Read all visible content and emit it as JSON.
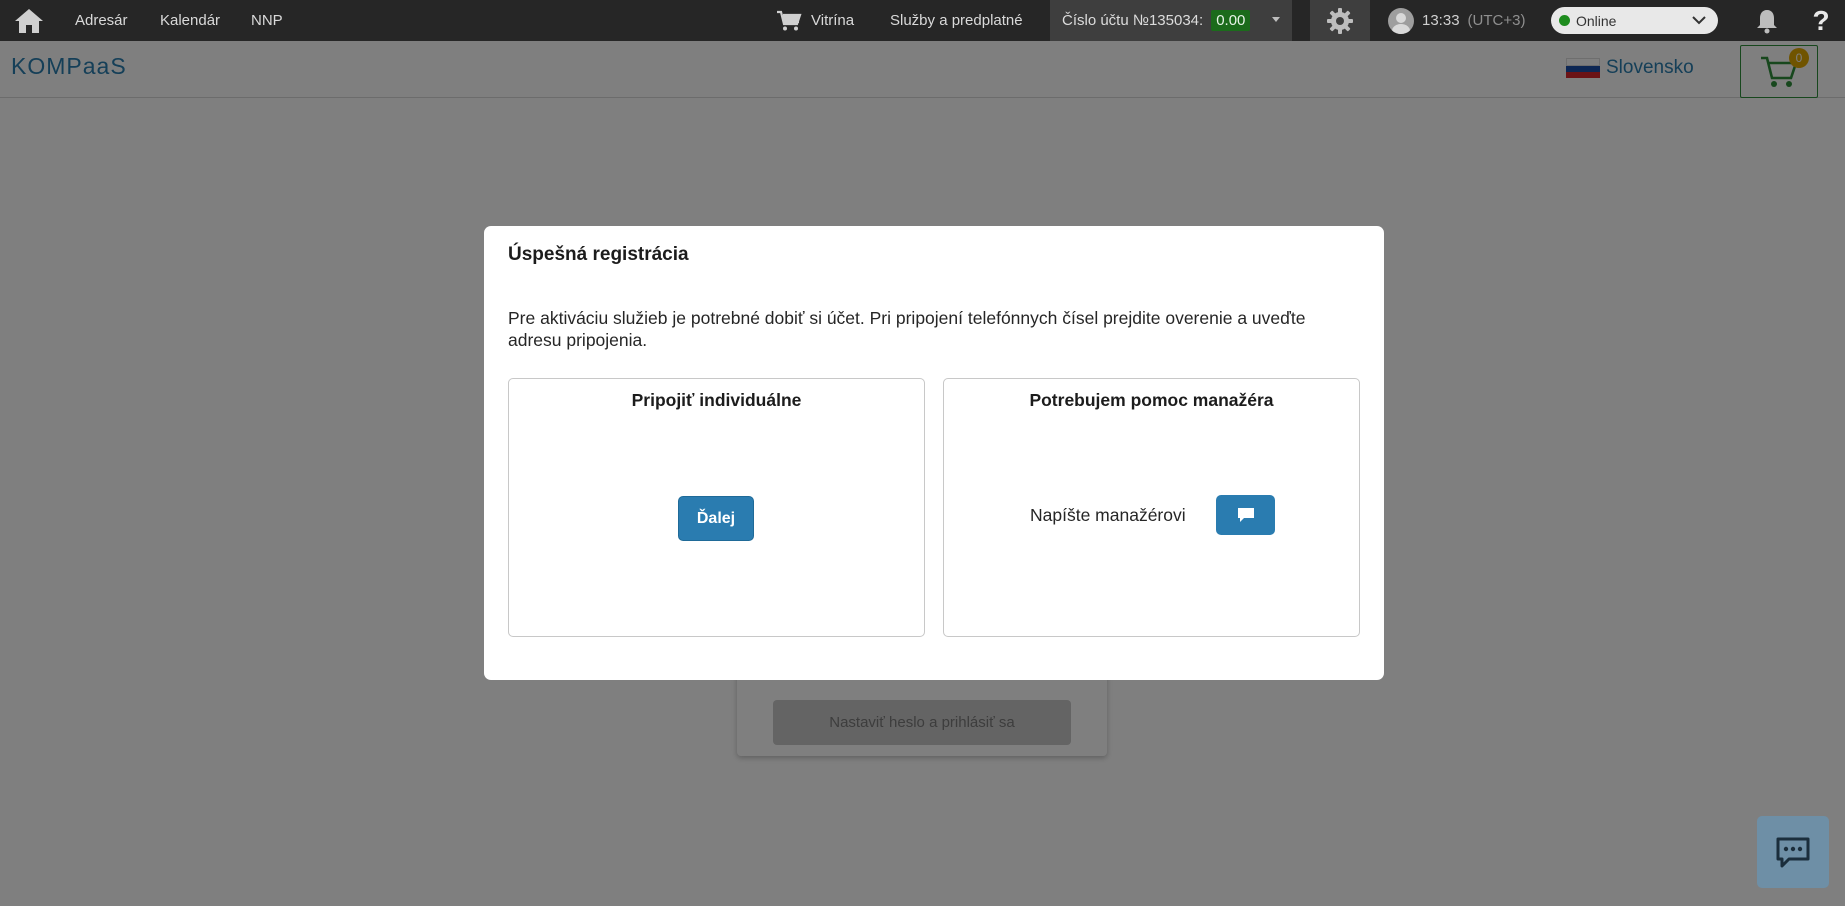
{
  "topbar": {
    "nav": [
      "Adresár",
      "Kalendár",
      "NNP"
    ],
    "vitrina": "Vitrína",
    "services": "Služby a predplatné",
    "account_label": "Číslo účtu №135034:",
    "balance": "0.00",
    "time": "13:33",
    "timezone": "(UTC+3)",
    "status": "Online"
  },
  "subheader": {
    "logo": "KOMPaaS",
    "language": "Slovensko",
    "cart_count": "0"
  },
  "background": {
    "button_label": "Nastaviť heslo a prihlásiť sa"
  },
  "modal": {
    "title": "Úspešná registrácia",
    "text": "Pre aktiváciu služieb je potrebné dobiť si účet. Pri pripojení telefónnych čísel prejdite overenie a uveďte adresu pripojenia.",
    "left_option": {
      "title": "Pripojiť individuálne",
      "button": "Ďalej"
    },
    "right_option": {
      "title": "Potrebujem pomoc manažéra",
      "label": "Napíšte manažérovi"
    }
  },
  "colors": {
    "accent": "#2a7cb0",
    "topbar": "#262626",
    "balance_bg": "#1b6b1b",
    "cart_border": "#2e8f3a",
    "badge": "#e0a800"
  }
}
